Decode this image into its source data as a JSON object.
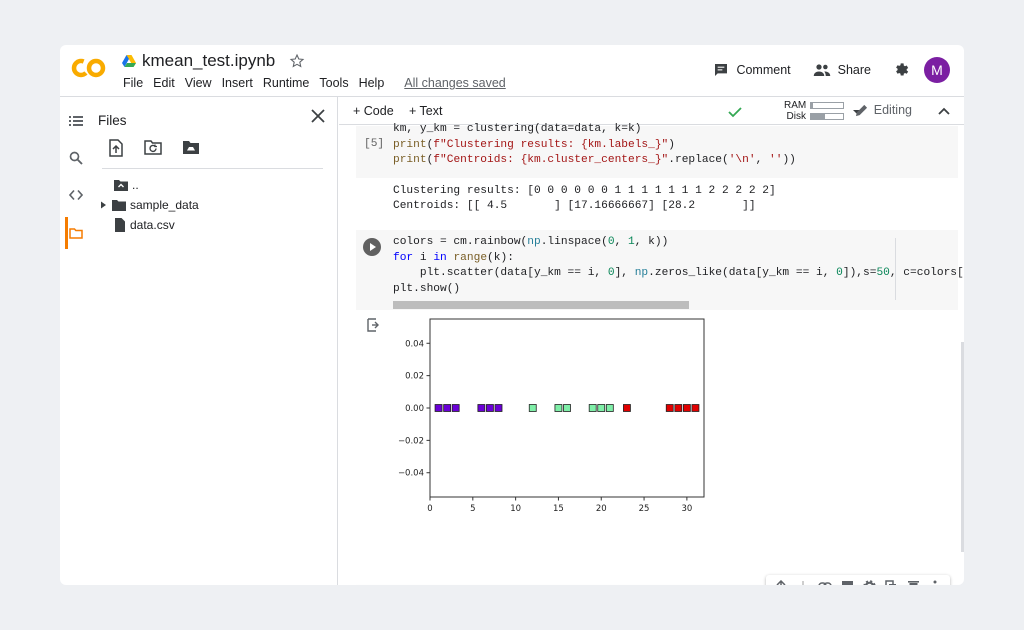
{
  "app": {
    "file_name": "kmean_test.ipynb",
    "menus": [
      "File",
      "Edit",
      "View",
      "Insert",
      "Runtime",
      "Tools",
      "Help"
    ],
    "saved_status": "All changes saved",
    "comment_label": "Comment",
    "share_label": "Share",
    "avatar_letter": "M",
    "logo_text": "CO"
  },
  "sidebar": {
    "title": "Files",
    "tree": [
      {
        "name": "..",
        "type": "parent"
      },
      {
        "name": "sample_data",
        "type": "folder"
      },
      {
        "name": "data.csv",
        "type": "file"
      }
    ]
  },
  "toolbar": {
    "code_label": "+ Code",
    "text_label": "+ Text",
    "ram_label": "RAM",
    "disk_label": "Disk",
    "ram_usage": 0.06,
    "disk_usage": 0.45,
    "editing_label": "Editing"
  },
  "cells": {
    "cell1": {
      "exec_count": "[5]",
      "output_line1": "Clustering results: [0 0 0 0 0 0 1 1 1 1 1 1 1 2 2 2 2 2]",
      "output_line2": "Centroids: [[ 4.5       ] [17.16666667] [28.2       ]]"
    },
    "cell2": {},
    "empty_cell": {}
  },
  "chart_data": {
    "type": "scatter",
    "title": "",
    "xlabel": "",
    "ylabel": "",
    "xlim": [
      0,
      32
    ],
    "ylim": [
      -0.055,
      0.055
    ],
    "x_ticks": [
      "0",
      "5",
      "10",
      "15",
      "20",
      "25",
      "30"
    ],
    "y_ticks": [
      "0.04",
      "0.02",
      "0.00",
      "−0.02",
      "−0.04"
    ],
    "marker": "square",
    "series": [
      {
        "color": "#6a00d6",
        "x": [
          1,
          2,
          3,
          6,
          7,
          8
        ],
        "y": [
          0,
          0,
          0,
          0,
          0,
          0
        ]
      },
      {
        "color": "#7fefa8",
        "x": [
          12,
          15,
          16,
          19,
          20,
          21
        ],
        "y": [
          0,
          0,
          0,
          0,
          0,
          0
        ]
      },
      {
        "color": "#e00000",
        "x": [
          23,
          28,
          29,
          30,
          31
        ],
        "y": [
          0,
          0,
          0,
          0,
          0
        ]
      }
    ]
  }
}
